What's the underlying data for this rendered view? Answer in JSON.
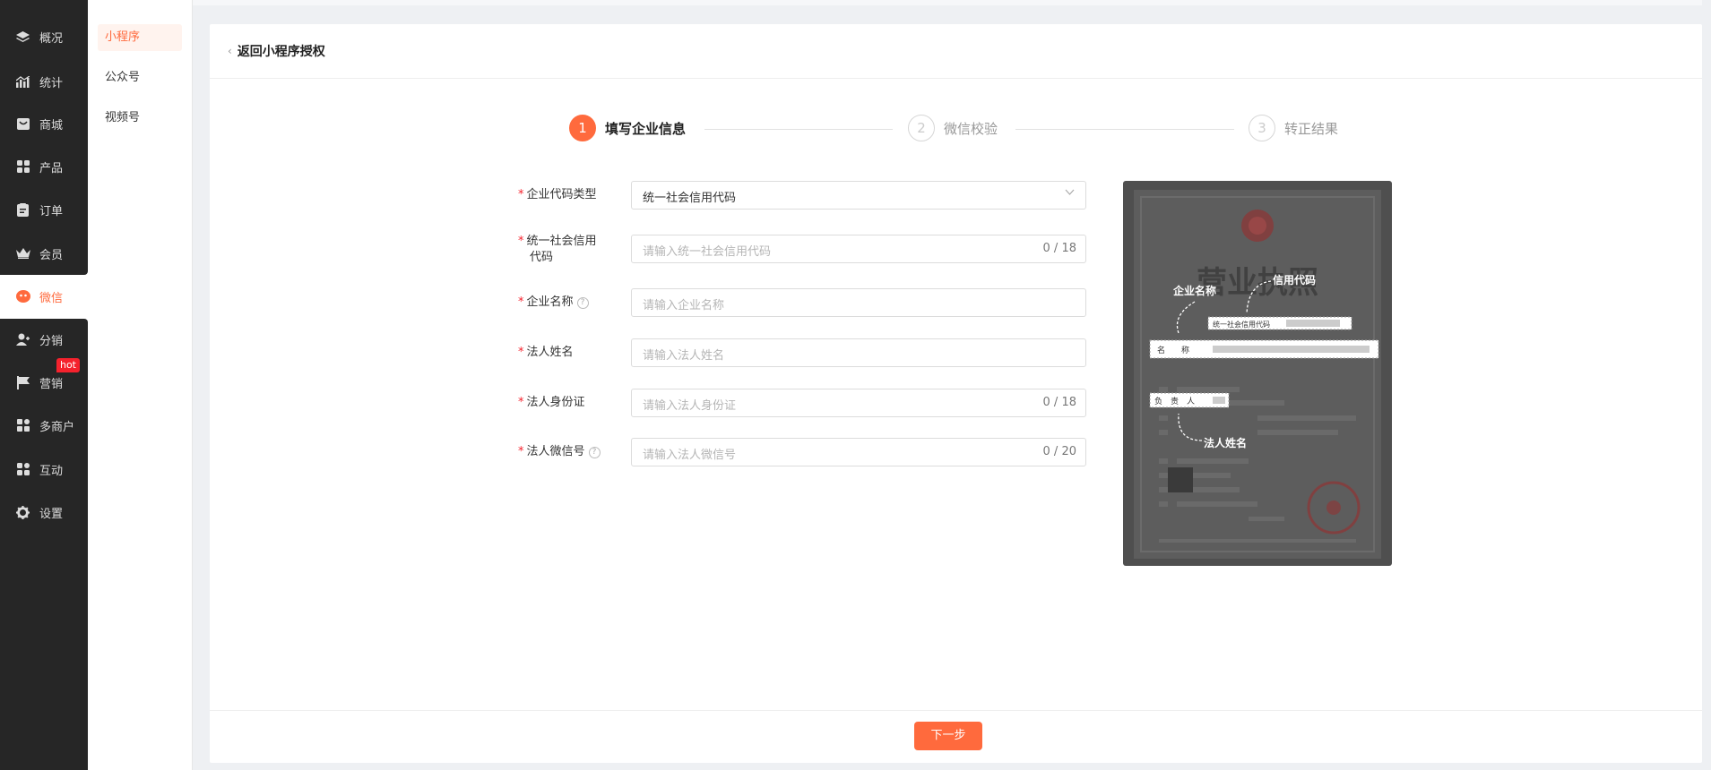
{
  "sidebar": {
    "items": [
      {
        "label": "概况",
        "icon": "layers-icon"
      },
      {
        "label": "统计",
        "icon": "stats-icon"
      },
      {
        "label": "商城",
        "icon": "mall-icon"
      },
      {
        "label": "产品",
        "icon": "grid-icon"
      },
      {
        "label": "订单",
        "icon": "order-icon"
      },
      {
        "label": "会员",
        "icon": "crown-icon"
      },
      {
        "label": "微信",
        "icon": "wechat-icon",
        "active": true
      },
      {
        "label": "分销",
        "icon": "user-share-icon"
      },
      {
        "label": "营销",
        "icon": "flag-icon"
      },
      {
        "label": "多商户",
        "icon": "store-icon"
      },
      {
        "label": "互动",
        "icon": "apps-icon"
      },
      {
        "label": "设置",
        "icon": "gear-icon"
      }
    ],
    "hot_badge": "hot"
  },
  "subnav": {
    "items": [
      {
        "label": "小程序",
        "active": true
      },
      {
        "label": "公众号"
      },
      {
        "label": "视频号"
      }
    ]
  },
  "header": {
    "back_label": "返回小程序授权"
  },
  "steps": [
    {
      "num": "1",
      "label": "填写企业信息",
      "state": "done"
    },
    {
      "num": "2",
      "label": "微信校验",
      "state": "todo"
    },
    {
      "num": "3",
      "label": "转正结果",
      "state": "todo"
    }
  ],
  "form": {
    "code_type": {
      "label": "企业代码类型",
      "value": "统一社会信用代码"
    },
    "credit_code": {
      "label_line1": "统一社会信用",
      "label_line2": "代码",
      "placeholder": "请输入统一社会信用代码",
      "count": "0 / 18"
    },
    "company_name": {
      "label": "企业名称",
      "placeholder": "请输入企业名称"
    },
    "legal_name": {
      "label": "法人姓名",
      "placeholder": "请输入法人姓名"
    },
    "legal_id": {
      "label": "法人身份证",
      "placeholder": "请输入法人身份证",
      "count": "0 / 18"
    },
    "legal_wechat": {
      "label": "法人微信号",
      "placeholder": "请输入法人微信号",
      "count": "0 / 20"
    },
    "required_mark": "*",
    "help_mark": "?"
  },
  "license_sample": {
    "annotations": {
      "company_name": "企业名称",
      "credit_code": "信用代码",
      "legal_name": "法人姓名"
    },
    "fields": {
      "credit_code_box": "统一社会信用代码",
      "name_box": "名　　称",
      "owner_box": "负　责　人"
    }
  },
  "footer": {
    "next_label": "下一步"
  },
  "colors": {
    "accent": "#ff6a3d",
    "sidebar_bg": "#262626",
    "required": "#f5222d"
  }
}
